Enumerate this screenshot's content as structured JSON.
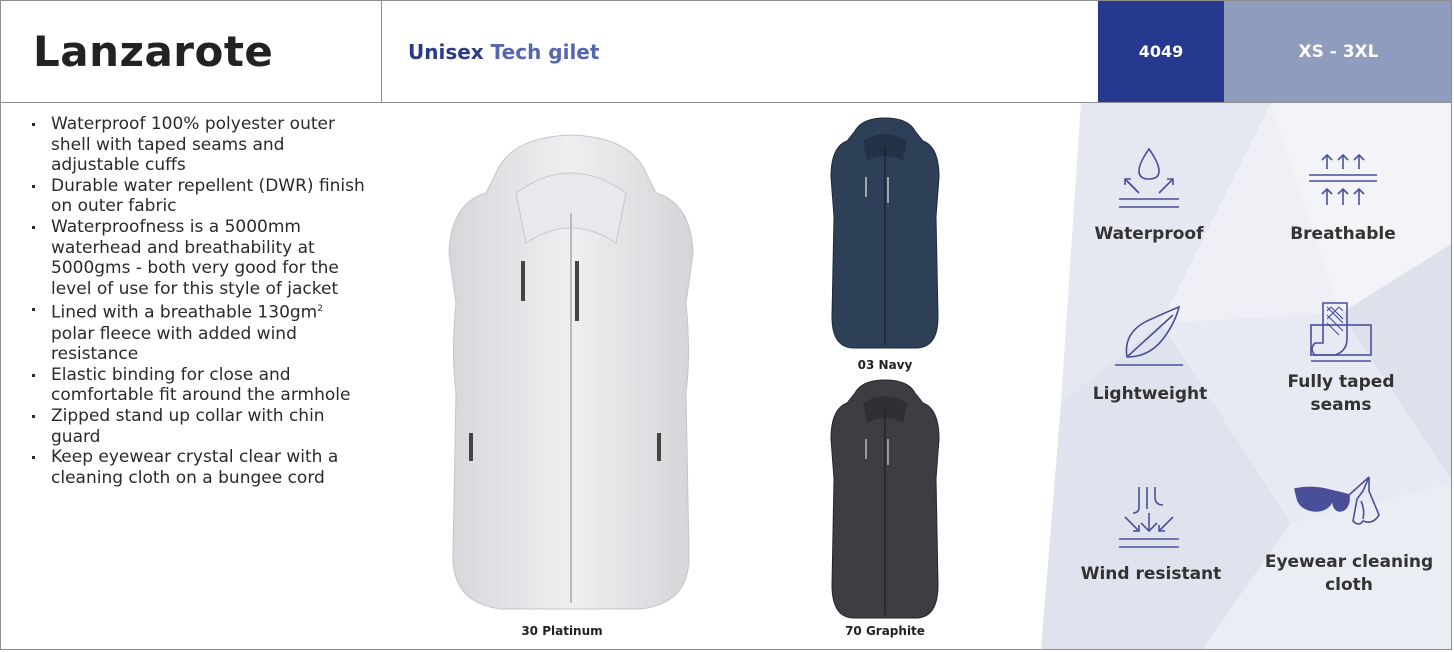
{
  "header": {
    "product_name": "Lanzarote",
    "desc_part1": "Unisex",
    "desc_part2": "Tech gilet",
    "code": "4049",
    "sizes": "XS - 3XL"
  },
  "features": [
    "Waterproof 100% polyester outer shell with taped seams and adjustable cuffs",
    "Durable water repellent (DWR) finish on outer fabric",
    "Waterproofness is a 5000mm waterhead and breathability at 5000gms - both very good for the level of use for this style of jacket",
    "Lined with a breathable 130gm",
    "polar fleece with added wind resistance",
    "Elastic binding for close and comfortable fit around the armhole",
    "Zipped stand up collar with chin guard",
    "Keep eyewear crystal clear with a cleaning cloth on a bungee cord"
  ],
  "feature_superscript": "2",
  "colors": {
    "brand": "#27398f",
    "sizes_bg": "#8f9cbd",
    "icon_stroke": "#4a4f9a"
  },
  "products": [
    {
      "label": "30 Platinum",
      "swatch": "#e3e4e6"
    },
    {
      "label": "03 Navy",
      "swatch": "#2c3e55"
    },
    {
      "label": "70 Graphite",
      "swatch": "#3b3d41"
    }
  ],
  "icons": [
    {
      "label": "Waterproof",
      "icon": "waterproof-icon"
    },
    {
      "label": "Breathable",
      "icon": "breathable-icon"
    },
    {
      "label": "Lightweight",
      "icon": "feather-icon"
    },
    {
      "label": "Fully taped seams",
      "icon": "taped-seams-icon"
    },
    {
      "label": "Wind resistant",
      "icon": "wind-icon"
    },
    {
      "label": "Eyewear cleaning cloth",
      "icon": "eyewear-cloth-icon"
    }
  ]
}
